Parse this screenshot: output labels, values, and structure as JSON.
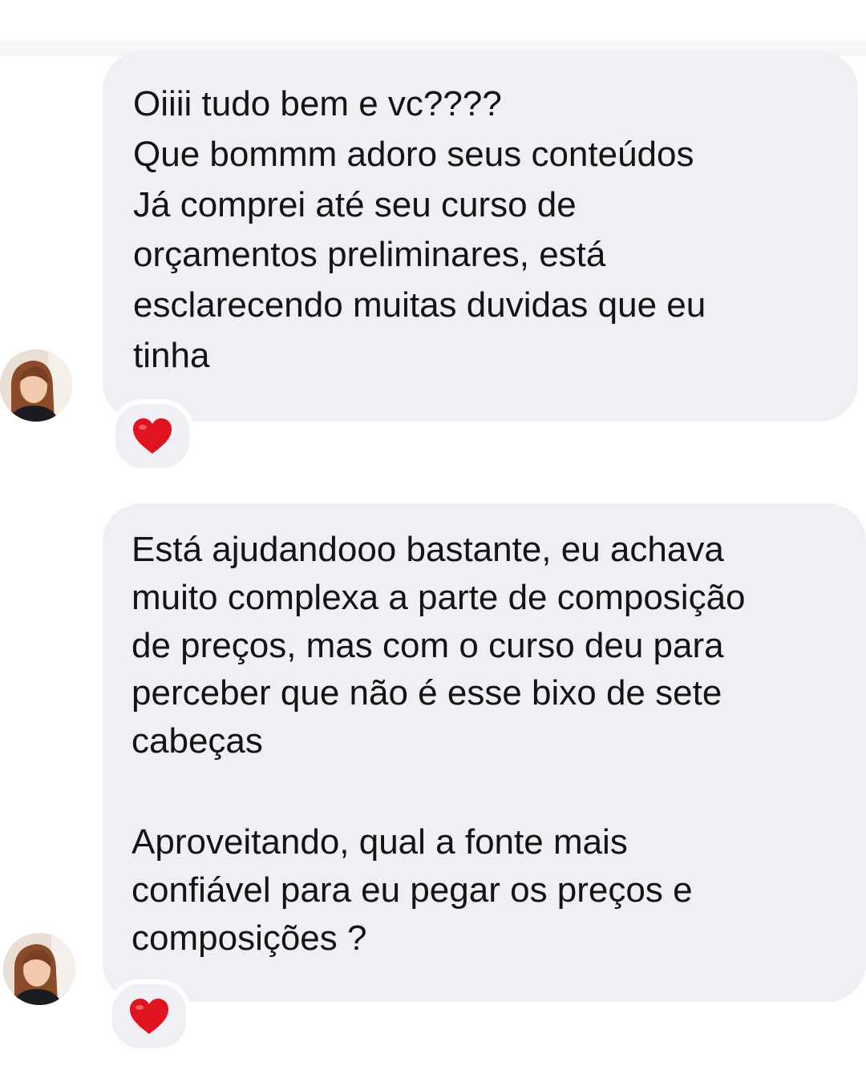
{
  "conversation": {
    "messages": [
      {
        "lines": [
          "Oiiii tudo bem e vc????",
          "Que bommm adoro seus conteúdos",
          "Já comprei até seu curso de",
          "orçamentos preliminares, está",
          "esclarecendo muitas duvidas que eu",
          "tinha"
        ],
        "reaction_icon": "red-heart-icon"
      },
      {
        "paragraph_1": [
          "Está ajudandooo bastante, eu achava",
          "muito complexa a parte de composição",
          "de preços, mas com o curso deu para",
          "perceber que não é esse bixo de sete",
          "cabeças"
        ],
        "paragraph_2": [
          "Aproveitando, qual a fonte mais",
          "confiável para eu pegar os preços e",
          "composições ?"
        ],
        "reaction_icon": "red-heart-icon"
      }
    ]
  },
  "colors": {
    "bubble_background": "#efeff4",
    "text": "#141414",
    "heart": "#e0141e",
    "page_background": "#ffffff"
  }
}
